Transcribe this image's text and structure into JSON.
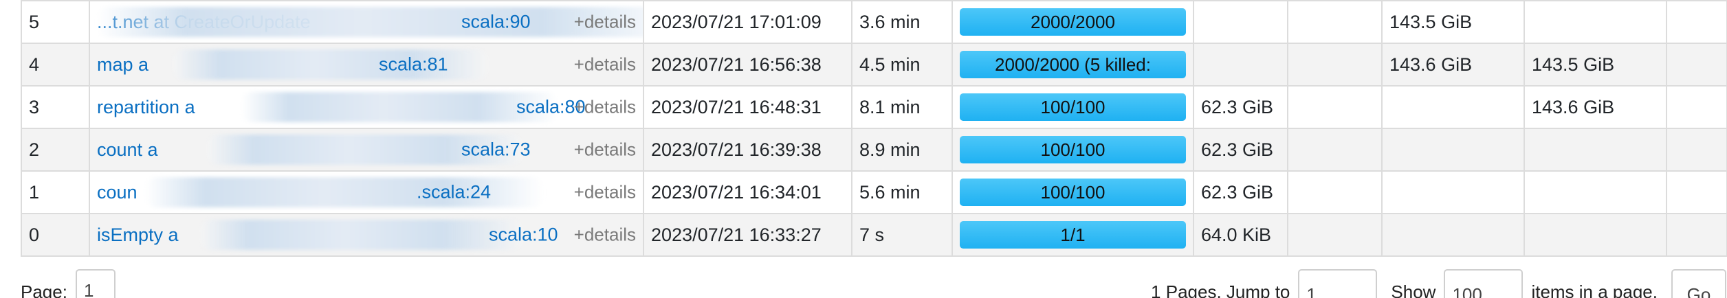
{
  "table": {
    "rows": [
      {
        "id": "5",
        "description_visible": "...t.net at CreateOrUpdate",
        "description_suffix": "scala:90",
        "details": "+details",
        "submitted": "2023/07/21 17:01:09",
        "duration": "3.6 min",
        "tasks_text": "2000/2000",
        "tasks_fraction": 1.0,
        "input": "",
        "output": "",
        "shuffle_read": "143.5 GiB",
        "shuffle_write": ""
      },
      {
        "id": "4",
        "description_visible": "map a",
        "description_suffix": "scala:81",
        "details": "+details",
        "submitted": "2023/07/21 16:56:38",
        "duration": "4.5 min",
        "tasks_text": "2000/2000 (5 killed:",
        "tasks_fraction": 1.0,
        "input": "",
        "output": "",
        "shuffle_read": "143.6 GiB",
        "shuffle_write": "143.5 GiB"
      },
      {
        "id": "3",
        "description_visible": "repartition a",
        "description_suffix": "scala:80",
        "details": "+details",
        "submitted": "2023/07/21 16:48:31",
        "duration": "8.1 min",
        "tasks_text": "100/100",
        "tasks_fraction": 1.0,
        "input": "62.3 GiB",
        "output": "",
        "shuffle_read": "",
        "shuffle_write": "143.6 GiB"
      },
      {
        "id": "2",
        "description_visible": "count a",
        "description_suffix": "scala:73",
        "details": "+details",
        "submitted": "2023/07/21 16:39:38",
        "duration": "8.9 min",
        "tasks_text": "100/100",
        "tasks_fraction": 1.0,
        "input": "62.3 GiB",
        "output": "",
        "shuffle_read": "",
        "shuffle_write": ""
      },
      {
        "id": "1",
        "description_visible": "coun",
        "description_suffix": ".scala:24",
        "details": "+details",
        "submitted": "2023/07/21 16:34:01",
        "duration": "5.6 min",
        "tasks_text": "100/100",
        "tasks_fraction": 1.0,
        "input": "62.3 GiB",
        "output": "",
        "shuffle_read": "",
        "shuffle_write": ""
      },
      {
        "id": "0",
        "description_visible": "isEmpty a",
        "description_suffix": "scala:10",
        "details": "+details",
        "submitted": "2023/07/21 16:33:27",
        "duration": "7 s",
        "tasks_text": "1/1",
        "tasks_fraction": 1.0,
        "input": "64.0 KiB",
        "output": "",
        "shuffle_read": "",
        "shuffle_write": ""
      }
    ]
  },
  "pagination": {
    "page_label": "Page:",
    "current_page": "1",
    "pages_text": "1 Pages. Jump to",
    "jump_value": "1",
    "show_label": "Show",
    "page_size_value": "100",
    "items_label": "items in a page.",
    "go_label": "Go"
  },
  "colors": {
    "link": "#0a6fc2",
    "progress_fill": "#1fb1f2",
    "row_stripe": "#f3f3f3",
    "border": "#dcdcdc"
  }
}
